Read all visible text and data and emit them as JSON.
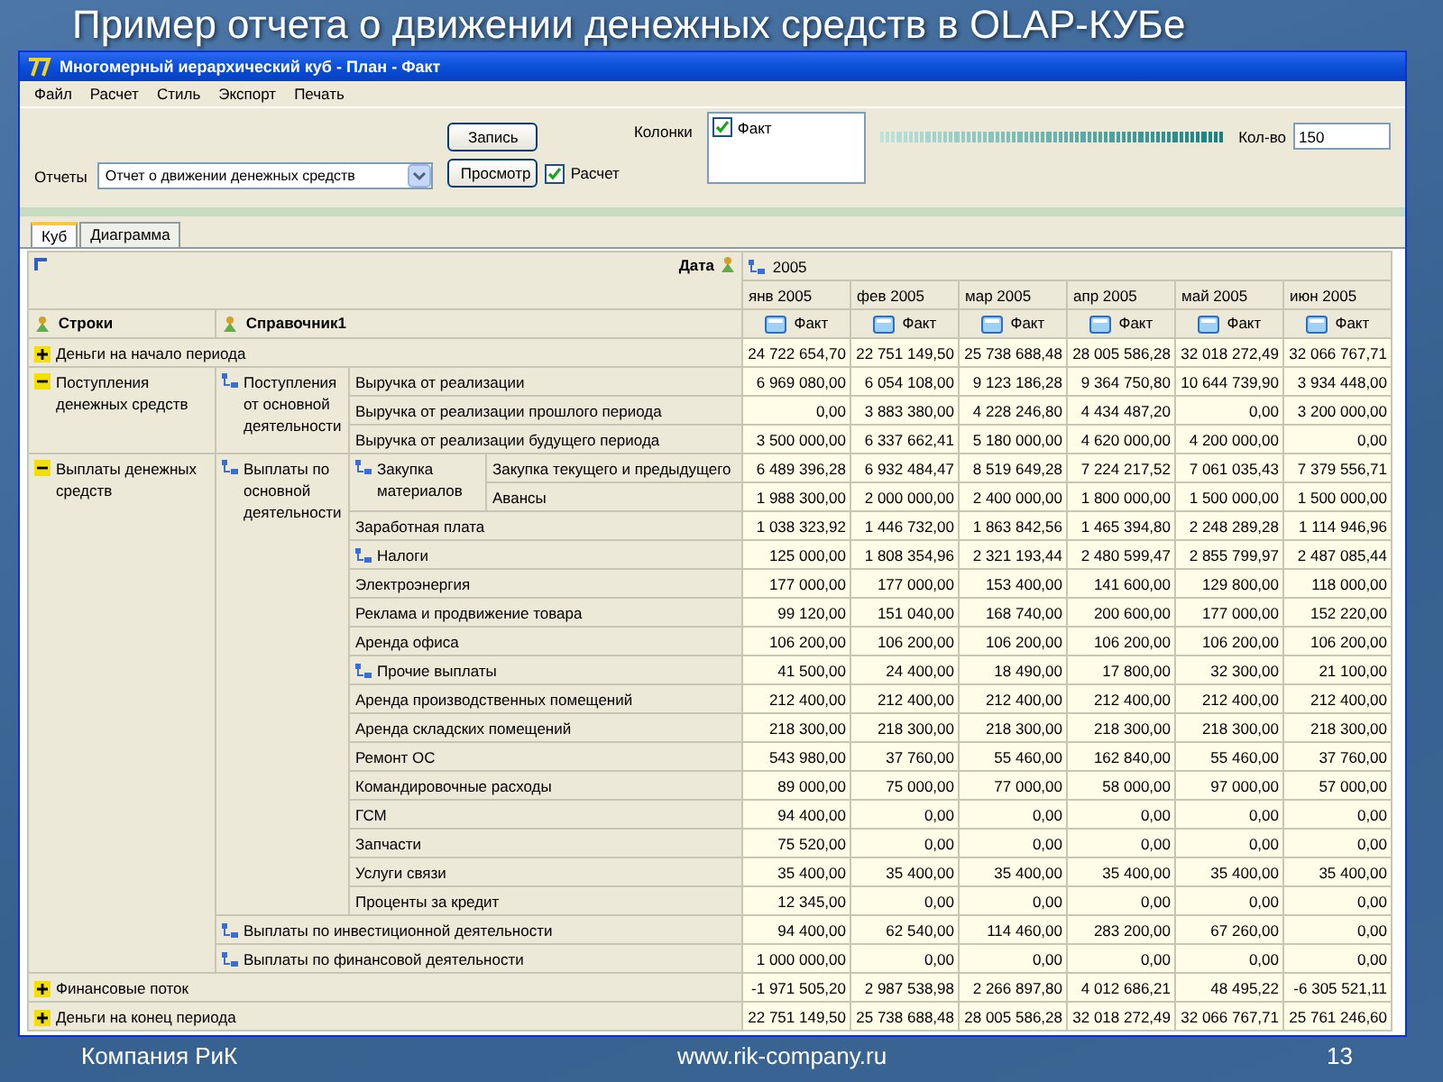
{
  "slide": {
    "title": "Пример отчета о движении денежных средств в OLAP-КУБе",
    "footer_left": "Компания РиК",
    "footer_center": "www.rik-company.ru",
    "page_number": "13"
  },
  "window": {
    "title": "Многомерный иерархический куб - План - Факт"
  },
  "menu": [
    "Файл",
    "Расчет",
    "Стиль",
    "Экспорт",
    "Печать"
  ],
  "toolbar": {
    "reports_label": "Отчеты",
    "report_value": "Отчет о движении денежных средств",
    "buttons": [
      "Запись",
      "Просмотр"
    ],
    "calc_checkbox": {
      "label": "Расчет",
      "checked": true
    },
    "columns_label": "Колонки",
    "columns_list": [
      {
        "label": "Факт",
        "checked": true
      }
    ],
    "progress": {
      "level": 1
    },
    "count_label": "Кол-во",
    "count_value": "150"
  },
  "tabs": [
    {
      "label": "Куб",
      "selected": true
    },
    {
      "label": "Диаграмма",
      "selected": false
    }
  ],
  "pivot": {
    "corner_label": "Дата",
    "year": "2005",
    "row_headers": [
      "Строки",
      "Справочник1"
    ],
    "columns": [
      {
        "month": "янв 2005",
        "measure": "Факт"
      },
      {
        "month": "фев 2005",
        "measure": "Факт"
      },
      {
        "month": "мар 2005",
        "measure": "Факт"
      },
      {
        "month": "апр 2005",
        "measure": "Факт"
      },
      {
        "month": "май 2005",
        "measure": "Факт"
      },
      {
        "month": "июн 2005",
        "measure": "Факт"
      }
    ],
    "rows": [
      {
        "label": "Деньги на начало периода",
        "expanded": false,
        "values": [
          "24 722 654,70",
          "22 751 149,50",
          "25 738 688,48",
          "28 005 586,28",
          "32 018 272,49",
          "32 066 767,71"
        ]
      },
      {
        "label": "Поступления денежных средств",
        "expanded": true,
        "children": [
          {
            "label": "Поступления от основной деятельности",
            "kind": "hierarchy",
            "children": [
              {
                "label": "Выручка от реализации",
                "values": [
                  "6 969 080,00",
                  "6 054 108,00",
                  "9 123 186,28",
                  "9 364 750,80",
                  "10 644 739,90",
                  "3 934 448,00"
                ]
              },
              {
                "label": "Выручка от реализации прошлого периода",
                "values": [
                  "0,00",
                  "3 883 380,00",
                  "4 228 246,80",
                  "4 434 487,20",
                  "0,00",
                  "3 200 000,00"
                ]
              },
              {
                "label": "Выручка от реализации будущего периода",
                "values": [
                  "3 500 000,00",
                  "6 337 662,41",
                  "5 180 000,00",
                  "4 620 000,00",
                  "4 200 000,00",
                  "0,00"
                ]
              }
            ]
          }
        ]
      },
      {
        "label": "Выплаты денежных средств",
        "expanded": true,
        "children": [
          {
            "label": "Выплаты по основной деятельности",
            "kind": "hierarchy",
            "children": [
              {
                "label": "Закупка материалов",
                "kind": "hierarchy",
                "children": [
                  {
                    "label": "Закупка текущего и предыдущего",
                    "values": [
                      "6 489 396,28",
                      "6 932 484,47",
                      "8 519 649,28",
                      "7 224 217,52",
                      "7 061 035,43",
                      "7 379 556,71"
                    ]
                  },
                  {
                    "label": "Авансы",
                    "values": [
                      "1 988 300,00",
                      "2 000 000,00",
                      "2 400 000,00",
                      "1 800 000,00",
                      "1 500 000,00",
                      "1 500 000,00"
                    ]
                  }
                ]
              },
              {
                "label": "Заработная плата",
                "values": [
                  "1 038 323,92",
                  "1 446 732,00",
                  "1 863 842,56",
                  "1 465 394,80",
                  "2 248 289,28",
                  "1 114 946,96"
                ]
              },
              {
                "label": "Налоги",
                "kind": "hierarchy",
                "values": [
                  "125 000,00",
                  "1 808 354,96",
                  "2 321 193,44",
                  "2 480 599,47",
                  "2 855 799,97",
                  "2 487 085,44"
                ]
              },
              {
                "label": "Электроэнергия",
                "values": [
                  "177 000,00",
                  "177 000,00",
                  "153 400,00",
                  "141 600,00",
                  "129 800,00",
                  "118 000,00"
                ]
              },
              {
                "label": "Реклама и продвижение товара",
                "values": [
                  "99 120,00",
                  "151 040,00",
                  "168 740,00",
                  "200 600,00",
                  "177 000,00",
                  "152 220,00"
                ]
              },
              {
                "label": "Аренда офиса",
                "values": [
                  "106 200,00",
                  "106 200,00",
                  "106 200,00",
                  "106 200,00",
                  "106 200,00",
                  "106 200,00"
                ]
              },
              {
                "label": "Прочие выплаты",
                "kind": "hierarchy",
                "values": [
                  "41 500,00",
                  "24 400,00",
                  "18 490,00",
                  "17 800,00",
                  "32 300,00",
                  "21 100,00"
                ]
              },
              {
                "label": "Аренда производственных помещений",
                "values": [
                  "212 400,00",
                  "212 400,00",
                  "212 400,00",
                  "212 400,00",
                  "212 400,00",
                  "212 400,00"
                ]
              },
              {
                "label": "Аренда складских помещений",
                "values": [
                  "218 300,00",
                  "218 300,00",
                  "218 300,00",
                  "218 300,00",
                  "218 300,00",
                  "218 300,00"
                ]
              },
              {
                "label": "Ремонт ОС",
                "values": [
                  "543 980,00",
                  "37 760,00",
                  "55 460,00",
                  "162 840,00",
                  "55 460,00",
                  "37 760,00"
                ]
              },
              {
                "label": "Командировочные расходы",
                "values": [
                  "89 000,00",
                  "75 000,00",
                  "77 000,00",
                  "58 000,00",
                  "97 000,00",
                  "57 000,00"
                ]
              },
              {
                "label": "ГСМ",
                "values": [
                  "94 400,00",
                  "0,00",
                  "0,00",
                  "0,00",
                  "0,00",
                  "0,00"
                ]
              },
              {
                "label": "Запчасти",
                "values": [
                  "75 520,00",
                  "0,00",
                  "0,00",
                  "0,00",
                  "0,00",
                  "0,00"
                ]
              },
              {
                "label": "Услуги связи",
                "values": [
                  "35 400,00",
                  "35 400,00",
                  "35 400,00",
                  "35 400,00",
                  "35 400,00",
                  "35 400,00"
                ]
              },
              {
                "label": "Проценты за кредит",
                "values": [
                  "12 345,00",
                  "0,00",
                  "0,00",
                  "0,00",
                  "0,00",
                  "0,00"
                ]
              }
            ]
          },
          {
            "label": "Выплаты по инвестиционной деятельности",
            "kind": "hierarchy",
            "values": [
              "94 400,00",
              "62 540,00",
              "114 460,00",
              "283 200,00",
              "67 260,00",
              "0,00"
            ]
          },
          {
            "label": "Выплаты по финансовой деятельности",
            "kind": "hierarchy",
            "values": [
              "1 000 000,00",
              "0,00",
              "0,00",
              "0,00",
              "0,00",
              "0,00"
            ]
          }
        ]
      },
      {
        "label": "Финансовые поток",
        "expanded": false,
        "values": [
          "-1 971 505,20",
          "2 987 538,98",
          "2 266 897,80",
          "4 012 686,21",
          "48 495,22",
          "-6 305 521,11"
        ]
      },
      {
        "label": "Деньги на конец периода",
        "expanded": false,
        "values": [
          "22 751 149,50",
          "25 738 688,48",
          "28 005 586,28",
          "32 018 272,49",
          "32 066 767,71",
          "25 761 246,60"
        ]
      }
    ]
  }
}
